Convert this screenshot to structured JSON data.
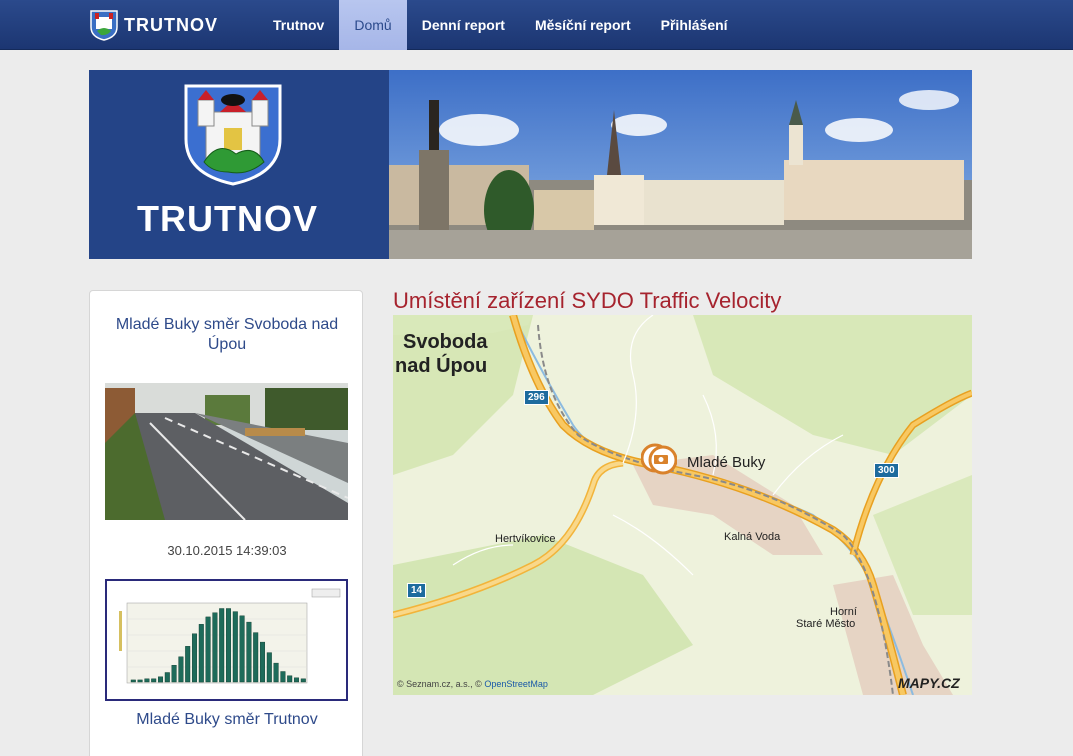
{
  "navbar": {
    "brand": "TRUTNOV",
    "items": [
      {
        "label": "Trutnov",
        "active": false
      },
      {
        "label": "Domů",
        "active": true
      },
      {
        "label": "Denní report",
        "active": false
      },
      {
        "label": "Měsíční report",
        "active": false
      },
      {
        "label": "Přihlášení",
        "active": false
      }
    ]
  },
  "banner": {
    "title": "TRUTNOV"
  },
  "sidebar": {
    "camera1": {
      "title": "Mladé Buky směr Svoboda nad Úpou",
      "timestamp": "30.10.2015 14:39:03"
    },
    "camera2": {
      "title": "Mladé Buky směr Trutnov"
    }
  },
  "map": {
    "heading": "Umístění zařízení SYDO Traffic Velocity",
    "places": {
      "svoboda_line1": "Svoboda",
      "svoboda_line2": "nad Úpou",
      "mlade_buky": "Mladé Buky",
      "hertvikovice": "Hertvíkovice",
      "kalna_voda": "Kalná Voda",
      "horni_line1": "Horní",
      "horni_line2": "Staré Město"
    },
    "roads": {
      "r296": "296",
      "r300": "300",
      "r14": "14"
    },
    "attribution": "© Seznam.cz, a.s., ©",
    "attribution_link": "OpenStreetMap",
    "provider_logo": "MAPY.CZ"
  },
  "colors": {
    "nav_bg": "#24428a",
    "accent": "#a6232e",
    "link": "#2e4a8a"
  }
}
